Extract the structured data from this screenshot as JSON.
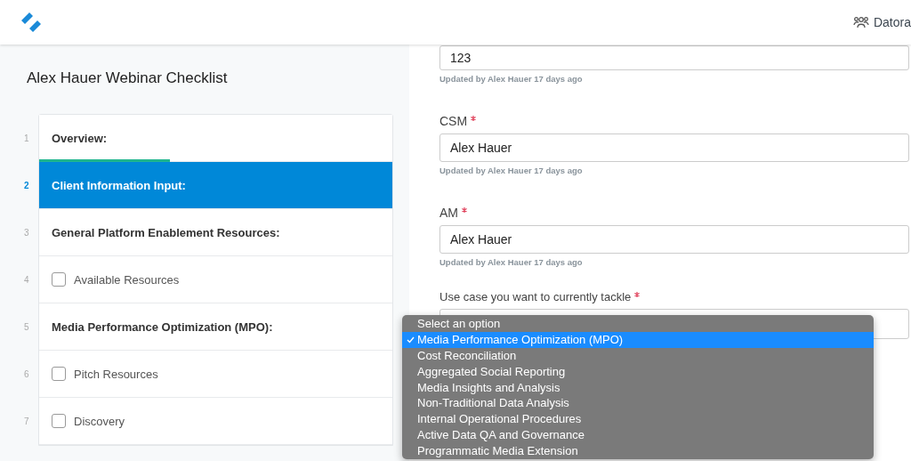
{
  "header": {
    "account": "Datora"
  },
  "checklist": {
    "title": "Alex Hauer Webinar Checklist",
    "progress": {
      "level": 0.37
    },
    "items": [
      {
        "number": "1",
        "kind": "heading",
        "label": "Overview:",
        "selected": false
      },
      {
        "number": "2",
        "kind": "heading",
        "label": "Client Information Input:",
        "selected": true
      },
      {
        "number": "3",
        "kind": "heading",
        "label": "General Platform Enablement Resources:",
        "selected": false
      },
      {
        "number": "4",
        "kind": "checkbox",
        "label": "Available Resources",
        "selected": false,
        "checked": false
      },
      {
        "number": "5",
        "kind": "heading",
        "label": "Media Performance Optimization (MPO):",
        "selected": false
      },
      {
        "number": "6",
        "kind": "checkbox",
        "label": "Pitch Resources",
        "selected": false,
        "checked": false
      },
      {
        "number": "7",
        "kind": "checkbox",
        "label": "Discovery",
        "selected": false,
        "checked": false
      }
    ]
  },
  "form": {
    "fields": [
      {
        "required": false,
        "value": "123",
        "updated": "Updated by Alex Hauer 17 days ago"
      },
      {
        "label": "CSM",
        "required": true,
        "value": "Alex Hauer",
        "updated": "Updated by Alex Hauer 17 days ago"
      },
      {
        "label": "AM",
        "required": true,
        "value": "Alex Hauer",
        "updated": "Updated by Alex Hauer 17 days ago"
      }
    ],
    "select": {
      "label": "Use case you want to currently tackle",
      "required": true,
      "options": [
        {
          "label": "Select an option",
          "selected": false
        },
        {
          "label": "Media Performance Optimization (MPO)",
          "selected": true
        },
        {
          "label": "Cost Reconciliation",
          "selected": false
        },
        {
          "label": "Aggregated Social Reporting",
          "selected": false
        },
        {
          "label": "Media Insights and Analysis",
          "selected": false
        },
        {
          "label": "Non-Traditional Data Analysis",
          "selected": false
        },
        {
          "label": "Internal Operational Procedures",
          "selected": false
        },
        {
          "label": "Active Data QA and Governance",
          "selected": false
        },
        {
          "label": "Programmatic Media Extension",
          "selected": false
        }
      ]
    }
  }
}
